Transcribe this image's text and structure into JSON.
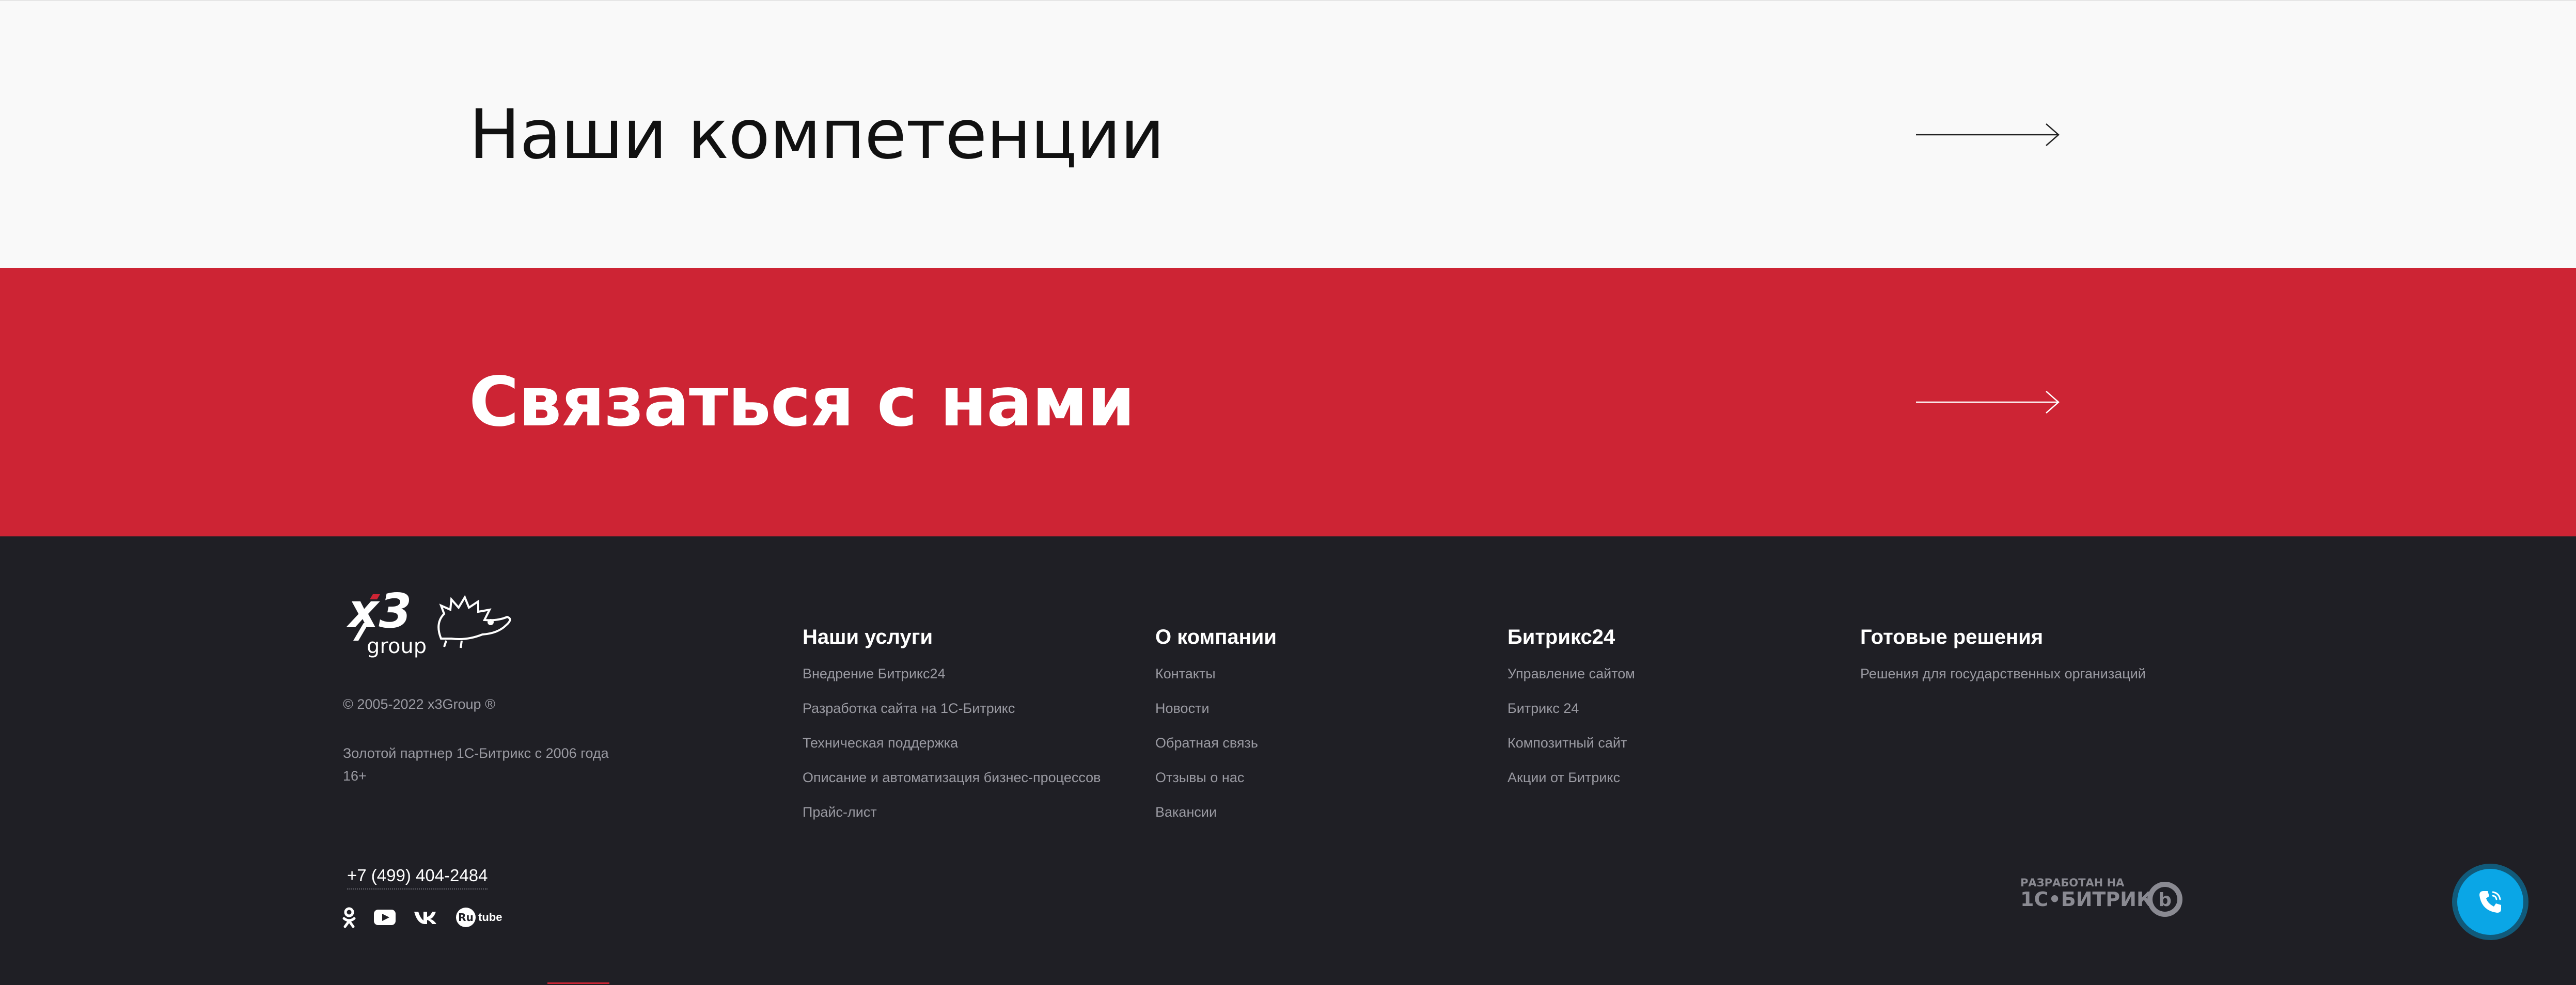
{
  "bands": {
    "competencies_title": "Наши компетенции",
    "contact_title": "Связаться с нами"
  },
  "footer": {
    "logo": {
      "brand": "x3",
      "sub": "group"
    },
    "copyright": "© 2005-2022 x3Group ®",
    "partner_line1": "Золотой партнер 1С-Битрикс с 2006 года",
    "partner_line2": "16+",
    "phone": "+7 (499) 404-2484",
    "columns": [
      {
        "title": "Наши услуги",
        "links": [
          "Внедрение Битрикс24",
          "Разработка сайта на 1С-Битрикс",
          "Техническая поддержка",
          "Описание и автоматизация бизнес-процессов",
          "Прайс-лист"
        ]
      },
      {
        "title": "О компании",
        "links": [
          "Контакты",
          "Новости",
          "Обратная связь",
          "Отзывы о нас",
          "Вакансии"
        ]
      },
      {
        "title": "Битрикс24",
        "links": [
          "Управление сайтом",
          "Битрикс 24",
          "Композитный сайт",
          "Акции от Битрикс"
        ]
      },
      {
        "title": "Готовые решения",
        "links": [
          "Решения для государственных организаций"
        ]
      }
    ],
    "socials": [
      "odnoklassniki-icon",
      "youtube-icon",
      "vk-icon",
      "rutube-icon"
    ],
    "rutube_label": "tube",
    "bitrix_badge": {
      "line1": "РАЗРАБОТАН НА",
      "line2": "1С•БИТРИКС"
    }
  },
  "colors": {
    "accent_red": "#cd2434",
    "footer_bg": "#1f1f25",
    "call_button": "#0aa6e6"
  }
}
